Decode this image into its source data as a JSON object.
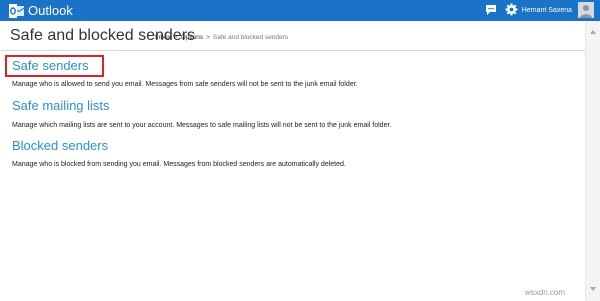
{
  "header": {
    "app_name": "Outlook",
    "user_name": "Hemant Saxena",
    "brand_color": "#1a73c7",
    "icons": [
      "outlook-logo-icon",
      "chat-icon",
      "gear-icon",
      "avatar"
    ]
  },
  "page": {
    "title": "Safe and blocked senders",
    "breadcrumb": {
      "inbox": "Inbox",
      "options": "Options",
      "current": "Safe and blocked senders",
      "separator": ">"
    }
  },
  "sections": [
    {
      "title": "Safe senders",
      "description": "Manage who is allowed to send you email. Messages from safe senders will not be sent to the junk email folder."
    },
    {
      "title": "Safe mailing lists",
      "description": "Manage which mailing lists are sent to your account. Messages to safe mailing lists will not be sent to the junk email folder."
    },
    {
      "title": "Blocked senders",
      "description": "Manage who is blocked from sending you email. Messages from blocked senders are automatically deleted."
    }
  ],
  "highlight_color": "#d9252a",
  "link_color": "#2f8fcf",
  "watermark": "wsxdn.com"
}
